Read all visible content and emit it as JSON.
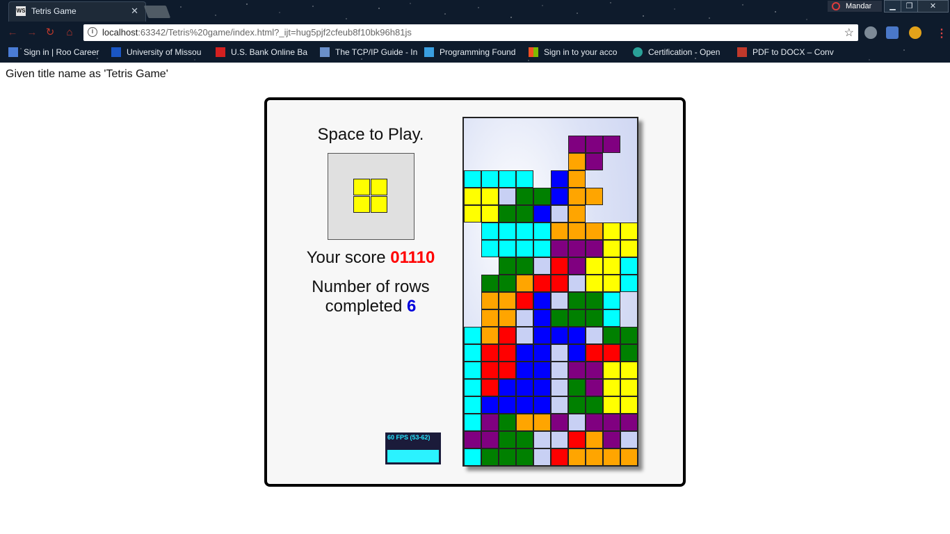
{
  "browser": {
    "tab_title": "Tetris Game",
    "tab_icon_text": "WS",
    "profile_name": "Mandar",
    "url_host": "localhost",
    "url_rest": ":63342/Tetris%20game/index.html?_ijt=hug5pjf2cfeub8f10bk96h81js",
    "bookmarks": [
      {
        "label": "Sign in | Roo Career",
        "color": "#4a7cd6"
      },
      {
        "label": "University of Missou",
        "color": "#1a56c4"
      },
      {
        "label": "U.S. Bank Online Ba",
        "color": "#d42020"
      },
      {
        "label": "The TCP/IP Guide - In",
        "color": "#6a8fc9"
      },
      {
        "label": "Programming Found",
        "color": "#3a9fe0"
      },
      {
        "label": "Sign in to your acco",
        "color": "#f25022"
      },
      {
        "label": "Certification - Open",
        "color": "#2aa198"
      },
      {
        "label": "PDF to DOCX – Conv",
        "color": "#c0392b"
      }
    ]
  },
  "page": {
    "caption": "Given title name as 'Tetris Game'"
  },
  "game": {
    "play_message": "Space to Play.",
    "score_label": "Your score",
    "score_value": "01110",
    "rows_label_line1": "Number of rows",
    "rows_label_line2": "completed",
    "rows_value": "6",
    "fps_text": "60 FPS (53-62)",
    "next_piece": "O",
    "colors": {
      "C": "#00ffff",
      "Y": "#ffff00",
      "G": "#008000",
      "B": "#0000ff",
      "O": "#ffa500",
      "P": "#800080",
      "R": "#ff0000",
      "L": "#c8d0f4"
    },
    "board_rows": [
      "..........",
      "......PPP.",
      "......OP..",
      "CCCC.BO...",
      "YYLGGBOO..",
      "YYGGBLO...",
      ".CCCCOOOYY",
      ".CCCCPPPYY",
      "..GGLRPYYC",
      ".GGORRLYYC",
      ".OORBLGGC.",
      ".OOLBGGGC.",
      "CORLBBBLGG",
      "CRRBBLBRRG",
      "CRRBBLPPYY",
      "CRBBBLGPYY",
      "CBBBBLGGYY",
      "CPGOOPLPPP",
      "PPGGLLROPL",
      "CGGGLROOOO"
    ]
  }
}
